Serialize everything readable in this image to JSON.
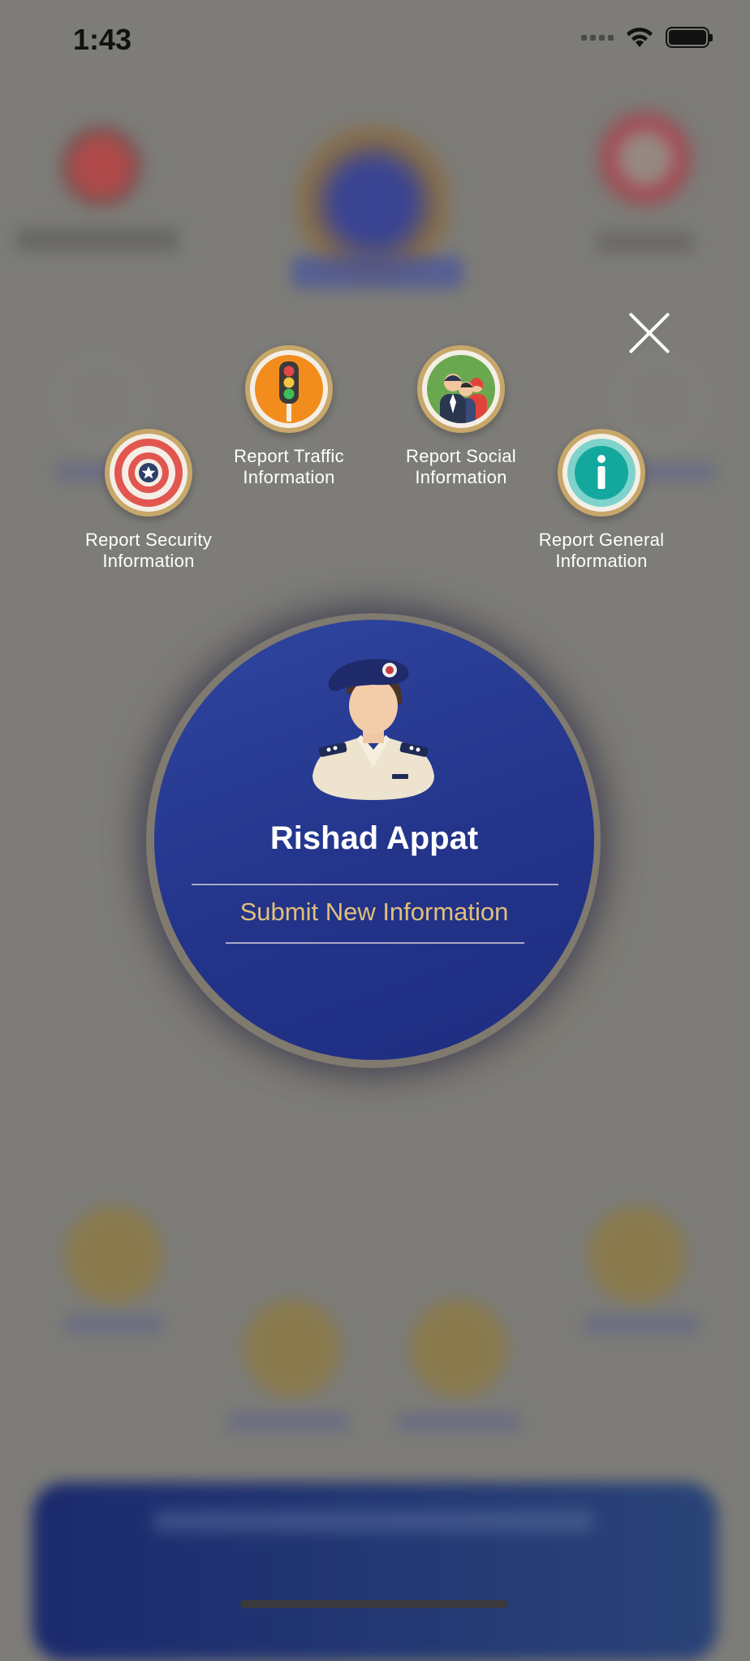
{
  "status_bar": {
    "time": "1:43"
  },
  "menu": {
    "options": [
      {
        "id": "security",
        "label": "Report Security\nInformation"
      },
      {
        "id": "traffic",
        "label": "Report Traffic\nInformation"
      },
      {
        "id": "social",
        "label": "Report Social\nInformation"
      },
      {
        "id": "general",
        "label": "Report General\nInformation"
      }
    ]
  },
  "profile": {
    "name": "Rishad Appat",
    "action_label": "Submit New Information"
  },
  "colors": {
    "overlay_gray": "#7d7c78",
    "profile_blue": "#23348a",
    "gold": "#c7a76a",
    "submit_text": "#e2bf7a"
  }
}
